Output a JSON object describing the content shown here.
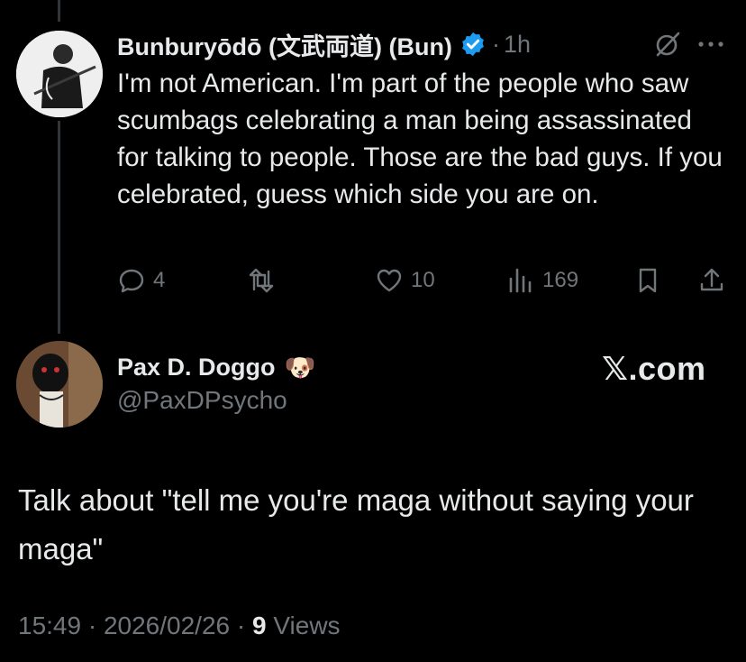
{
  "tweet": {
    "author_name": "Bunburyōdō (文武両道) (Bun)",
    "separator": "·",
    "time": "1h",
    "text": "I'm not American. I'm part of the people who saw scumbags celebrating a man being assassinated for talking to people. Those are the bad guys. If you celebrated, guess which side you are on.",
    "actions": {
      "replies": "4",
      "likes": "10",
      "views": "169"
    },
    "icons": [
      "verified-badge-icon",
      "grok-icon",
      "more-icon",
      "reply-icon",
      "retweet-icon",
      "like-icon",
      "views-icon",
      "bookmark-icon",
      "share-icon"
    ]
  },
  "reply": {
    "author_name": "Pax D. Doggo",
    "emoji": "🐶",
    "handle": "@PaxDPsycho",
    "brand": "𝕏.com",
    "text": "Talk about \"tell me you're maga without saying your maga\"",
    "meta": {
      "time": "15:49",
      "sep1": "·",
      "date": "2026/02/26",
      "sep2": "·",
      "views_count": "9",
      "views_label": "Views"
    }
  },
  "colors": {
    "background": "#000000",
    "text": "#e7e9ea",
    "muted": "#71767b",
    "verified": "#1d9bf0"
  }
}
